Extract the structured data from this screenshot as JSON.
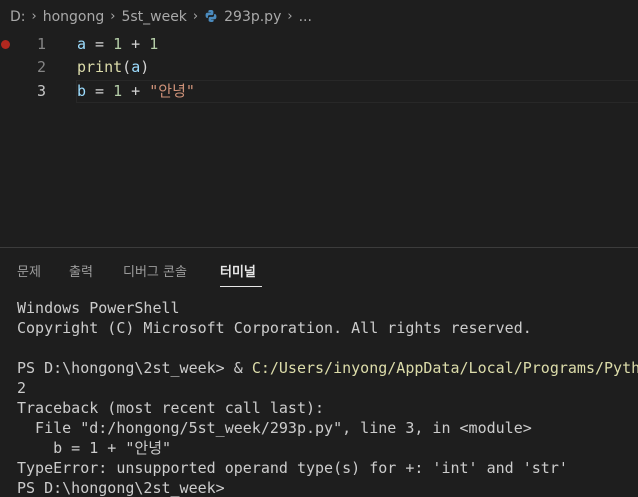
{
  "breadcrumb": {
    "drive": "D:",
    "folder1": "hongong",
    "folder2": "5st_week",
    "file": "293p.py",
    "more": "..."
  },
  "editor": {
    "lines": [
      {
        "number": "1",
        "tokens": [
          {
            "t": "a",
            "c": "var"
          },
          {
            "t": " = ",
            "c": "op"
          },
          {
            "t": "1",
            "c": "num"
          },
          {
            "t": " + ",
            "c": "op"
          },
          {
            "t": "1",
            "c": "num"
          }
        ]
      },
      {
        "number": "2",
        "tokens": [
          {
            "t": "print",
            "c": "fn"
          },
          {
            "t": "(",
            "c": "op"
          },
          {
            "t": "a",
            "c": "var"
          },
          {
            "t": ")",
            "c": "op"
          }
        ]
      },
      {
        "number": "3",
        "tokens": [
          {
            "t": "b",
            "c": "var"
          },
          {
            "t": " = ",
            "c": "op"
          },
          {
            "t": "1",
            "c": "num"
          },
          {
            "t": " + ",
            "c": "op"
          },
          {
            "t": "\"안녕\"",
            "c": "str"
          }
        ]
      }
    ]
  },
  "panel": {
    "tabs": [
      "문제",
      "출력",
      "디버그 콘솔",
      "터미널"
    ],
    "active_tab": "터미널"
  },
  "terminal": {
    "lines": [
      {
        "text": "Windows PowerShell"
      },
      {
        "text": "Copyright (C) Microsoft Corporation. All rights reserved."
      },
      {
        "text": ""
      },
      {
        "text": "PS D:\\hongong\\2st_week> & ",
        "path": "C:/Users/inyong/AppData/Local/Programs/Pyth"
      },
      {
        "text": "2"
      },
      {
        "text": "Traceback (most recent call last):"
      },
      {
        "text": "  File \"d:/hongong/5st_week/293p.py\", line 3, in <module>"
      },
      {
        "text": "    b = 1 + \"안녕\""
      },
      {
        "text": "TypeError: unsupported operand type(s) for +: 'int' and 'str'"
      },
      {
        "text": "PS D:\\hongong\\2st_week>"
      }
    ]
  },
  "colors": {
    "background": "#1e1e1e",
    "breakpoint": "#b1281f",
    "string": "#ce9178",
    "number": "#b5cea8",
    "function": "#dcdcaa",
    "variable": "#9cdcfe"
  },
  "icons": {
    "file_icon": "python-file-icon",
    "breakpoint": "breakpoint-icon"
  }
}
